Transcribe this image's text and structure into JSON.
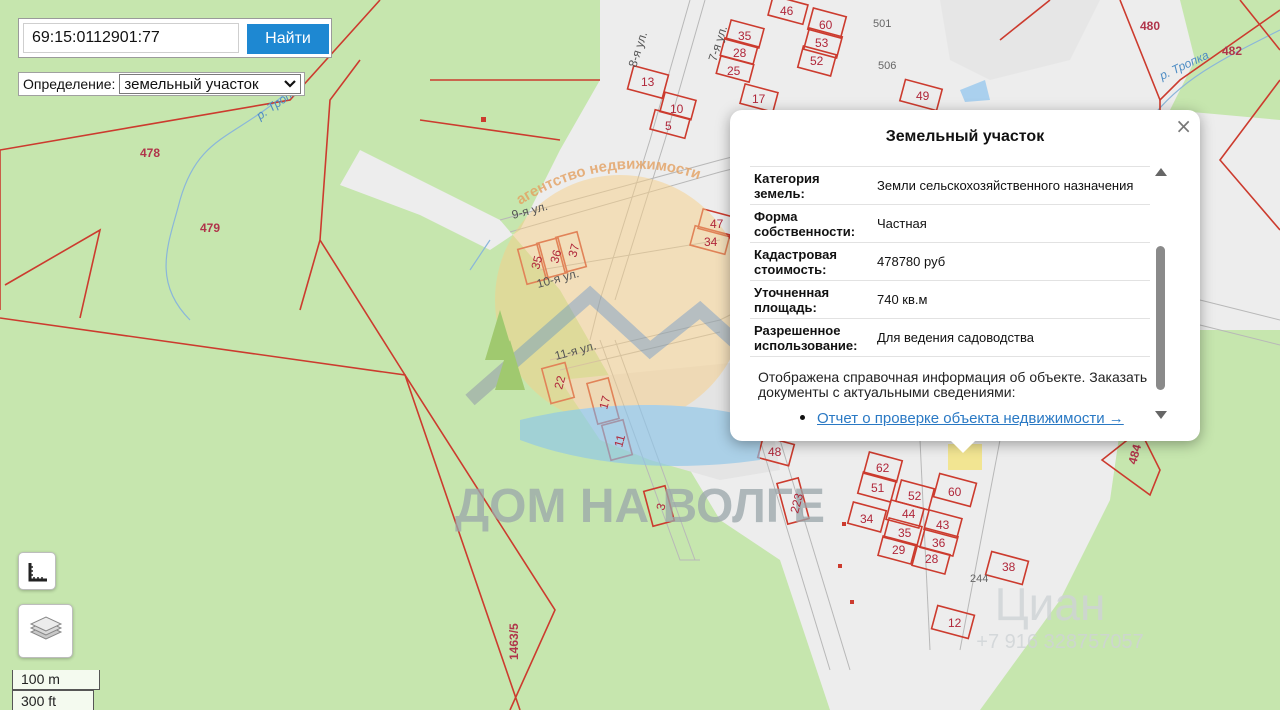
{
  "search": {
    "value": "69:15:0112901:77",
    "button_label": "Найти"
  },
  "definition": {
    "label": "Определение:",
    "selected": "земельный участок"
  },
  "scale": {
    "metric": "100 m",
    "imperial": "300 ft"
  },
  "popup": {
    "title": "Земельный участок",
    "close_label": "×",
    "rows": [
      {
        "key": "Категория земель:",
        "value": "Земли сельскохозяйственного назначения"
      },
      {
        "key": "Форма собственности:",
        "value": "Частная"
      },
      {
        "key": "Кадастровая стоимость:",
        "value": "478780 руб"
      },
      {
        "key": "Уточненная площадь:",
        "value": "740 кв.м"
      },
      {
        "key": "Разрешенное использование:",
        "value": "Для ведения садоводства"
      }
    ],
    "note": "Отображена справочная информация об объекте. Заказать документы с актуальными сведениями:",
    "link": "Отчет о проверке объекта недвижимости →"
  },
  "map_labels": {
    "streets": [
      "9-я ул.",
      "10-я ул.",
      "11-я ул.",
      "8-я ул.",
      "7-я ул."
    ],
    "rivers": [
      "р. Тропка",
      "р. Тропка"
    ],
    "parcels_green": [
      "478",
      "479",
      "480",
      "482",
      "484",
      "1463/5"
    ],
    "plots": [
      "13",
      "10",
      "5",
      "35",
      "28",
      "25",
      "17",
      "46",
      "60",
      "53",
      "52",
      "49",
      "47",
      "34",
      "35",
      "36",
      "37",
      "22",
      "17",
      "11",
      "3",
      "48",
      "223",
      "62",
      "51",
      "52",
      "60",
      "34",
      "44",
      "43",
      "35",
      "36",
      "29",
      "28",
      "38",
      "12"
    ],
    "others": [
      "501",
      "506",
      "244"
    ]
  },
  "watermarks": {
    "brand": "ДОМ НА ВОЛГЕ",
    "arc": "агентство недвижимости",
    "cian": "Циан",
    "phone": "+7 916 328757057"
  },
  "colors": {
    "forest": "#bfe3a8",
    "clearing": "#eeeeee",
    "boundary": "#cc3b2e",
    "button": "#1e88d2",
    "link": "#2a79c4"
  }
}
